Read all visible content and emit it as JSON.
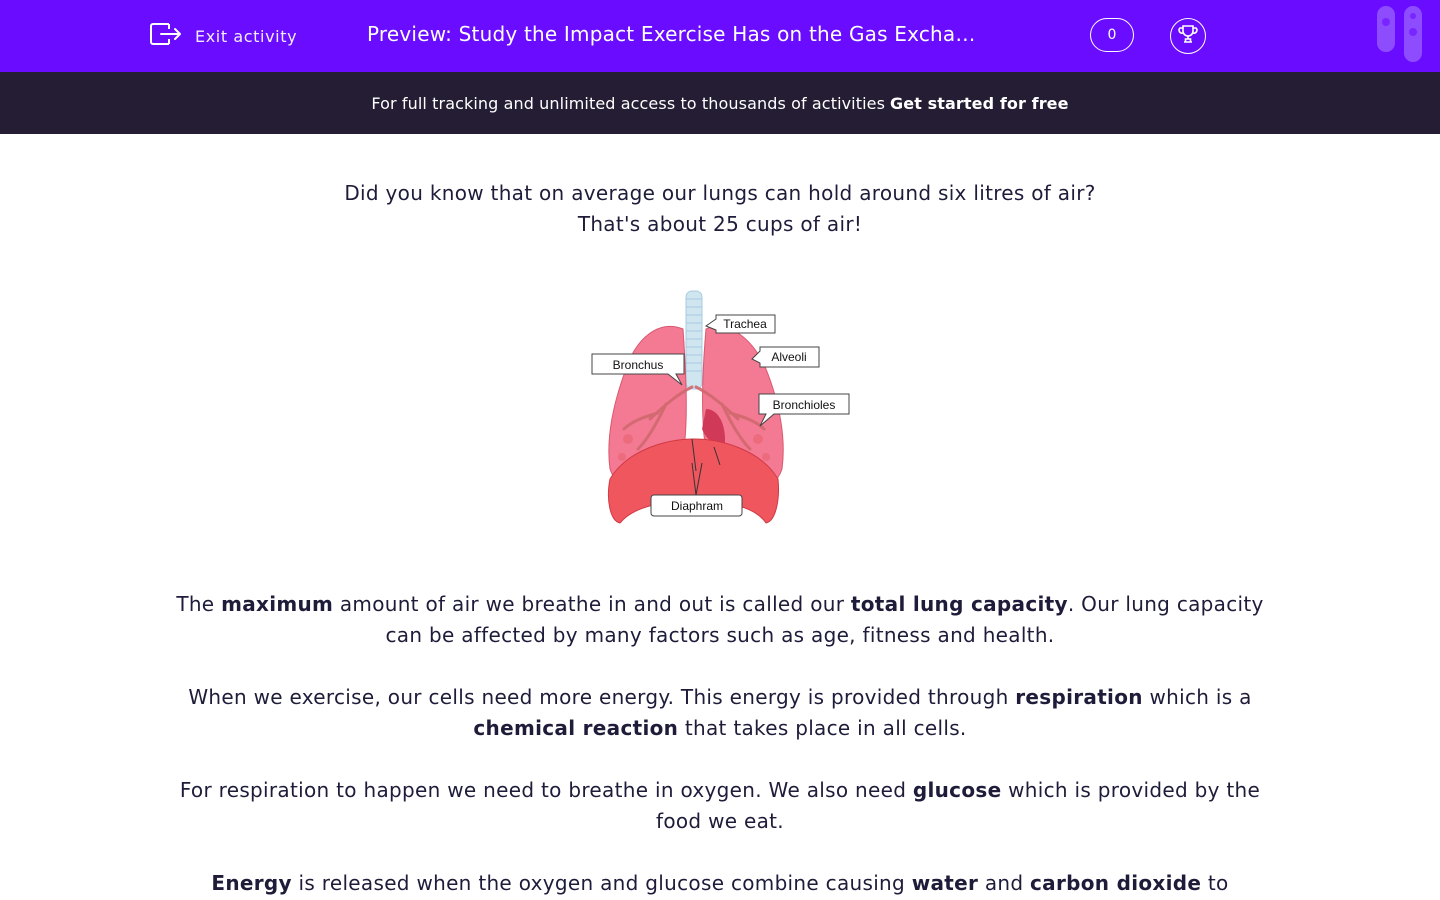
{
  "header": {
    "exit_label": "Exit activity",
    "title": "Preview: Study the Impact Exercise Has on the Gas Excha…",
    "score": "0"
  },
  "banner": {
    "text": "For full tracking and unlimited access to thousands of activities",
    "cta": "Get started for free"
  },
  "intro": {
    "line1": "Did you know that on average our lungs can hold around six litres of air?",
    "line2": "That's about 25 cups of air!"
  },
  "diagram": {
    "labels": {
      "trachea": "Trachea",
      "alveoli": "Alveoli",
      "bronchus": "Bronchus",
      "bronchioles": "Bronchioles",
      "diaphragm": "Diaphram"
    }
  },
  "paragraphs": {
    "p1": [
      "The ",
      "maximum",
      " amount of air we breathe in and out is called our ",
      "total lung capacity",
      ". Our lung capacity can be affected by many factors such as age, fitness and health."
    ],
    "p2": [
      "When we exercise, our cells need more energy. This energy is provided through ",
      "respiration",
      " which is a ",
      "chemical reaction",
      " that takes place in all cells."
    ],
    "p3": [
      "For respiration to happen we need to breathe in oxygen. We also need ",
      "glucose",
      " which is provided by the food we eat."
    ],
    "p4": [
      "Energy",
      " is released when the oxygen and glucose combine causing ",
      "water",
      " and ",
      "carbon dioxide",
      " to"
    ]
  },
  "colors": {
    "brand_purple": "#6a0cff",
    "banner_dark": "#241d34",
    "text": "#1f1c3a",
    "lung_pink": "#f37a92",
    "diaphragm_red": "#f0565e"
  }
}
